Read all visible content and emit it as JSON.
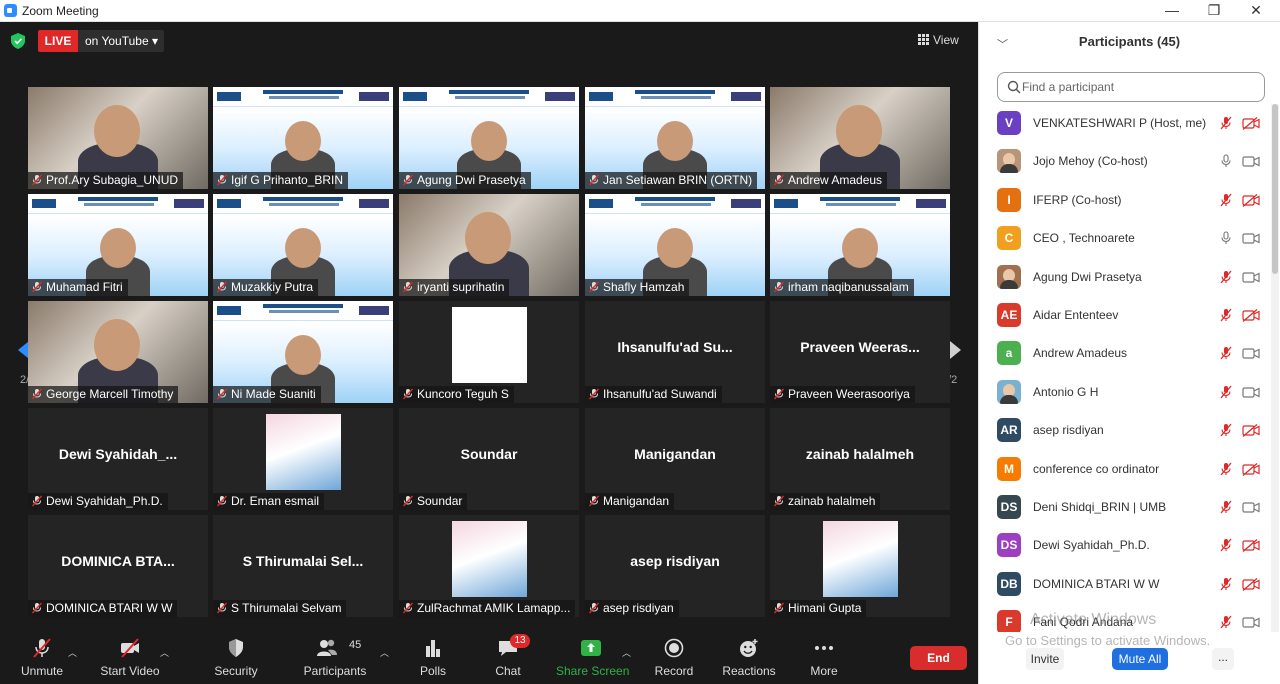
{
  "window": {
    "title": "Zoom Meeting",
    "minimize": "—",
    "restore": "❐",
    "close": "✕"
  },
  "topbar": {
    "live_label": "LIVE",
    "stream_label": "on YouTube ▾",
    "view_label": "View"
  },
  "gallery": {
    "page_indicator_left": "2/2",
    "page_indicator_right": "2/2",
    "tiles": [
      {
        "name": "Prof.Ary Subagia_UNUD",
        "kind": "video"
      },
      {
        "name": "Igif G Prihanto_BRIN",
        "kind": "slide"
      },
      {
        "name": "Agung Dwi Prasetya",
        "kind": "slide"
      },
      {
        "name": "Jan Setiawan BRIN (ORTN)",
        "kind": "slide"
      },
      {
        "name": "Andrew Amadeus",
        "kind": "video"
      },
      {
        "name": "Muhamad Fitri",
        "kind": "slide"
      },
      {
        "name": "Muzakkiy Putra",
        "kind": "slide"
      },
      {
        "name": "iryanti suprihatin",
        "kind": "video"
      },
      {
        "name": "Shafly Hamzah",
        "kind": "slide"
      },
      {
        "name": "irham naqibanussalam",
        "kind": "slide"
      },
      {
        "name": "George Marcell Timothy",
        "kind": "video"
      },
      {
        "name": "Ni Made Suaniti",
        "kind": "slide"
      },
      {
        "name": "Kuncoro Teguh S",
        "kind": "blank"
      },
      {
        "name": "Ihsanulfu'ad Suwandi",
        "kind": "text",
        "big": "Ihsanulfu'ad  Su..."
      },
      {
        "name": "Praveen Weerasooriya",
        "kind": "text",
        "big": "Praveen  Weeras..."
      },
      {
        "name": "Dewi Syahidah_Ph.D.",
        "kind": "text",
        "big": "Dewi  Syahidah_..."
      },
      {
        "name": "Dr. Eman esmail",
        "kind": "thumb"
      },
      {
        "name": "Soundar",
        "kind": "text",
        "big": "Soundar"
      },
      {
        "name": "Manigandan",
        "kind": "text",
        "big": "Manigandan"
      },
      {
        "name": "zainab halalmeh",
        "kind": "text",
        "big": "zainab halalmeh"
      },
      {
        "name": "DOMINICA BTARI W W",
        "kind": "text",
        "big": "DOMINICA  BTA..."
      },
      {
        "name": "S Thirumalai Selvam",
        "kind": "text",
        "big": "S  Thirumalai  Sel..."
      },
      {
        "name": "ZulRachmat AMIK Lamapp...",
        "kind": "thumb"
      },
      {
        "name": "asep risdiyan",
        "kind": "text",
        "big": "asep risdiyan"
      },
      {
        "name": "Himani Gupta",
        "kind": "thumb"
      }
    ]
  },
  "toolbar": {
    "unmute": "Unmute",
    "start_video": "Start Video",
    "security": "Security",
    "participants": "Participants",
    "participants_count": "45",
    "polls": "Polls",
    "chat": "Chat",
    "chat_badge": "13",
    "share_screen": "Share Screen",
    "record": "Record",
    "reactions": "Reactions",
    "more": "More",
    "end": "End"
  },
  "panel": {
    "title": "Participants (45)",
    "search_placeholder": "Find a participant",
    "invite": "Invite",
    "mute_all": "Mute All",
    "more": "...",
    "participants": [
      {
        "name": "VENKATESHWARI P (Host, me)",
        "initials": "V",
        "color": "#6a3fc1",
        "mic": "muted",
        "cam": "off"
      },
      {
        "name": "Jojo Mehoy (Co-host)",
        "initials": "",
        "color": "#b89478",
        "mic": "on",
        "cam": "on"
      },
      {
        "name": "IFERP (Co-host)",
        "initials": "I",
        "color": "#e5700f",
        "mic": "muted",
        "cam": "off"
      },
      {
        "name": "CEO , Technoarete",
        "initials": "C",
        "color": "#f0a01e",
        "mic": "on",
        "cam": "on"
      },
      {
        "name": "Agung Dwi Prasetya",
        "initials": "",
        "color": "#a07050",
        "mic": "muted",
        "cam": "on"
      },
      {
        "name": "Aidar Ententeev",
        "initials": "AE",
        "color": "#d93a2b",
        "mic": "muted",
        "cam": "off"
      },
      {
        "name": "Andrew Amadeus",
        "initials": "a",
        "color": "#4caf50",
        "mic": "muted",
        "cam": "on"
      },
      {
        "name": "Antonio G H",
        "initials": "",
        "color": "#7ab0d0",
        "mic": "muted",
        "cam": "on"
      },
      {
        "name": "asep risdiyan",
        "initials": "AR",
        "color": "#2f4a63",
        "mic": "muted",
        "cam": "off"
      },
      {
        "name": "conference co ordinator",
        "initials": "M",
        "color": "#f57c00",
        "mic": "muted",
        "cam": "off"
      },
      {
        "name": "Deni Shidqi_BRIN | UMB",
        "initials": "DS",
        "color": "#37474f",
        "mic": "muted",
        "cam": "on"
      },
      {
        "name": "Dewi Syahidah_Ph.D.",
        "initials": "DS",
        "color": "#9c3fc1",
        "mic": "muted",
        "cam": "off"
      },
      {
        "name": "DOMINICA BTARI W W",
        "initials": "DB",
        "color": "#2f4a63",
        "mic": "muted",
        "cam": "off"
      },
      {
        "name": "Fani Qodri Andana",
        "initials": "F",
        "color": "#d93a2b",
        "mic": "muted",
        "cam": "on"
      }
    ]
  },
  "watermark": {
    "line1": "Activate Windows",
    "line2": "Go to Settings to activate Windows."
  },
  "colors": {
    "live": "#e02828",
    "end": "#d92c2c",
    "mute_all": "#1f6fe0",
    "share": "#2fb344",
    "muted_icon": "#e02828"
  }
}
